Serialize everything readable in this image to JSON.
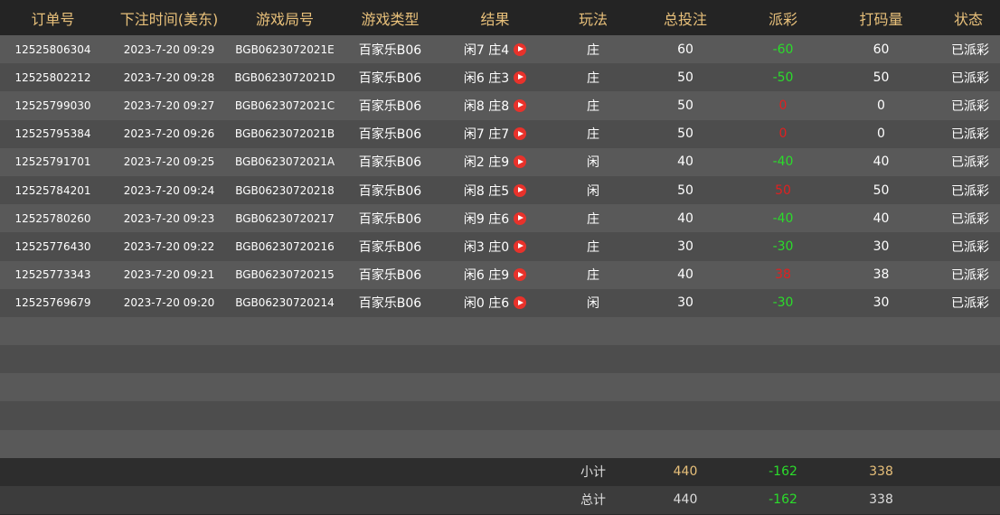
{
  "columns": {
    "order_no": "订单号",
    "bet_time": "下注时间(美东)",
    "round_no": "游戏局号",
    "game_type": "游戏类型",
    "result": "结果",
    "play": "玩法",
    "total_bet": "总投注",
    "payout": "派彩",
    "code_amount": "打码量",
    "status": "状态"
  },
  "rows": [
    {
      "order_no": "12525806304",
      "bet_time": "2023-7-20 09:29",
      "round_no": "BGB0623072021E",
      "game_type": "百家乐B06",
      "result": "闲7 庄4",
      "play": "庄",
      "total_bet": "60",
      "payout": "-60",
      "payout_sign": "neg",
      "code_amount": "60",
      "status": "已派彩"
    },
    {
      "order_no": "12525802212",
      "bet_time": "2023-7-20 09:28",
      "round_no": "BGB0623072021D",
      "game_type": "百家乐B06",
      "result": "闲6 庄3",
      "play": "庄",
      "total_bet": "50",
      "payout": "-50",
      "payout_sign": "neg",
      "code_amount": "50",
      "status": "已派彩"
    },
    {
      "order_no": "12525799030",
      "bet_time": "2023-7-20 09:27",
      "round_no": "BGB0623072021C",
      "game_type": "百家乐B06",
      "result": "闲8 庄8",
      "play": "庄",
      "total_bet": "50",
      "payout": "0",
      "payout_sign": "zero",
      "code_amount": "0",
      "status": "已派彩"
    },
    {
      "order_no": "12525795384",
      "bet_time": "2023-7-20 09:26",
      "round_no": "BGB0623072021B",
      "game_type": "百家乐B06",
      "result": "闲7 庄7",
      "play": "庄",
      "total_bet": "50",
      "payout": "0",
      "payout_sign": "zero",
      "code_amount": "0",
      "status": "已派彩"
    },
    {
      "order_no": "12525791701",
      "bet_time": "2023-7-20 09:25",
      "round_no": "BGB0623072021A",
      "game_type": "百家乐B06",
      "result": "闲2 庄9",
      "play": "闲",
      "total_bet": "40",
      "payout": "-40",
      "payout_sign": "neg",
      "code_amount": "40",
      "status": "已派彩"
    },
    {
      "order_no": "12525784201",
      "bet_time": "2023-7-20 09:24",
      "round_no": "BGB06230720218",
      "game_type": "百家乐B06",
      "result": "闲8 庄5",
      "play": "闲",
      "total_bet": "50",
      "payout": "50",
      "payout_sign": "pos",
      "code_amount": "50",
      "status": "已派彩"
    },
    {
      "order_no": "12525780260",
      "bet_time": "2023-7-20 09:23",
      "round_no": "BGB06230720217",
      "game_type": "百家乐B06",
      "result": "闲9 庄6",
      "play": "庄",
      "total_bet": "40",
      "payout": "-40",
      "payout_sign": "neg",
      "code_amount": "40",
      "status": "已派彩"
    },
    {
      "order_no": "12525776430",
      "bet_time": "2023-7-20 09:22",
      "round_no": "BGB06230720216",
      "game_type": "百家乐B06",
      "result": "闲3 庄0",
      "play": "庄",
      "total_bet": "30",
      "payout": "-30",
      "payout_sign": "neg",
      "code_amount": "30",
      "status": "已派彩"
    },
    {
      "order_no": "12525773343",
      "bet_time": "2023-7-20 09:21",
      "round_no": "BGB06230720215",
      "game_type": "百家乐B06",
      "result": "闲6 庄9",
      "play": "庄",
      "total_bet": "40",
      "payout": "38",
      "payout_sign": "pos",
      "code_amount": "38",
      "status": "已派彩"
    },
    {
      "order_no": "12525769679",
      "bet_time": "2023-7-20 09:20",
      "round_no": "BGB06230720214",
      "game_type": "百家乐B06",
      "result": "闲0 庄6",
      "play": "闲",
      "total_bet": "30",
      "payout": "-30",
      "payout_sign": "neg",
      "code_amount": "30",
      "status": "已派彩"
    }
  ],
  "empty_row_count": 5,
  "subtotal": {
    "label": "小计",
    "total_bet": "440",
    "payout": "-162",
    "code_amount": "338"
  },
  "total": {
    "label": "总计",
    "total_bet": "440",
    "payout": "-162",
    "code_amount": "338"
  },
  "colors": {
    "header_text": "#e8c07a",
    "negative_payout": "#2bdc2b",
    "positive_payout": "#e02020",
    "play_icon": "#e8322b"
  },
  "icons": {
    "result_replay": "play-circle-icon"
  }
}
